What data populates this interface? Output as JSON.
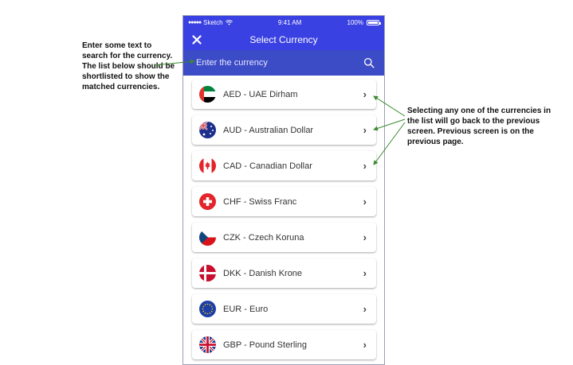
{
  "annotations": {
    "left": "Enter some text to search for the currency. The list below should be shortlisted to show the matched currencies.",
    "right": "Selecting any one of the currencies in the list will go back to the previous screen. Previous screen is on the previous page."
  },
  "status_bar": {
    "carrier": "Sketch",
    "time": "9:41 AM",
    "battery": "100%"
  },
  "nav": {
    "title": "Select Currency",
    "close_icon": "close-icon"
  },
  "search": {
    "placeholder": "Enter the currency",
    "icon": "search-icon"
  },
  "currencies": [
    {
      "label": "AED - UAE Dirham",
      "flag": "uae-flag-icon"
    },
    {
      "label": "AUD - Australian Dollar",
      "flag": "australia-flag-icon"
    },
    {
      "label": "CAD - Canadian Dollar",
      "flag": "canada-flag-icon"
    },
    {
      "label": "CHF - Swiss Franc",
      "flag": "switzerland-flag-icon"
    },
    {
      "label": "CZK - Czech Koruna",
      "flag": "czech-flag-icon"
    },
    {
      "label": "DKK - Danish Krone",
      "flag": "denmark-flag-icon"
    },
    {
      "label": "EUR - Euro",
      "flag": "eu-flag-icon"
    },
    {
      "label": "GBP - Pound Sterling",
      "flag": "uk-flag-icon"
    }
  ],
  "colors": {
    "header": "#3a41e2",
    "search_bar": "#3c4bc6",
    "annotation_arrow": "#3a8a2e"
  }
}
